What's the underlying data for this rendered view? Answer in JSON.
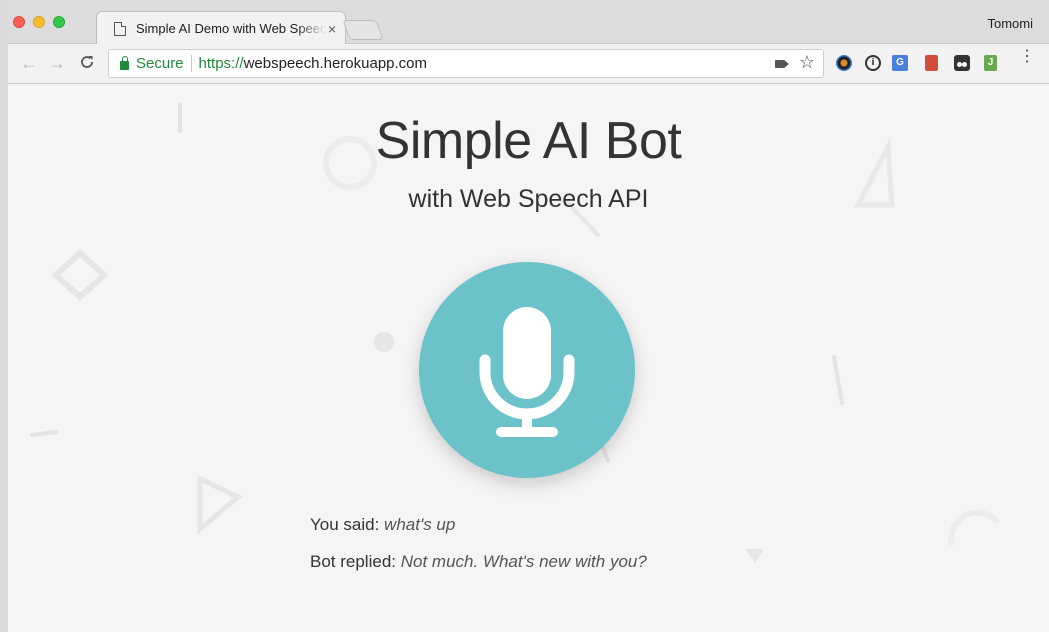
{
  "browser": {
    "tab": {
      "title": "Simple AI Demo with Web Speech API",
      "close": "×"
    },
    "profile_name": "Tomomi",
    "nav": {
      "back": "←",
      "forward": "→",
      "reload": "C"
    },
    "omnibox": {
      "security_label": "Secure",
      "url_scheme": "https://",
      "url_host": "webspeech.herokuapp.com"
    },
    "extensions": [
      "colorpicker-icon",
      "onepassword-icon",
      "translate-icon",
      "bookmark-icon",
      "tampermonkey-icon",
      "evernote-icon"
    ],
    "ext_labels": {
      "onepassword": "i",
      "translate": "G",
      "evernote": "J"
    },
    "menu": "⋮",
    "star": "☆"
  },
  "page": {
    "title": "Simple AI Bot",
    "subtitle": "with Web Speech API",
    "mic_color": "#6cc2c9",
    "you_said_label": "You said: ",
    "you_said_value": "what's up",
    "bot_replied_label": "Bot replied: ",
    "bot_replied_value": "Not much. What's new with you?"
  }
}
